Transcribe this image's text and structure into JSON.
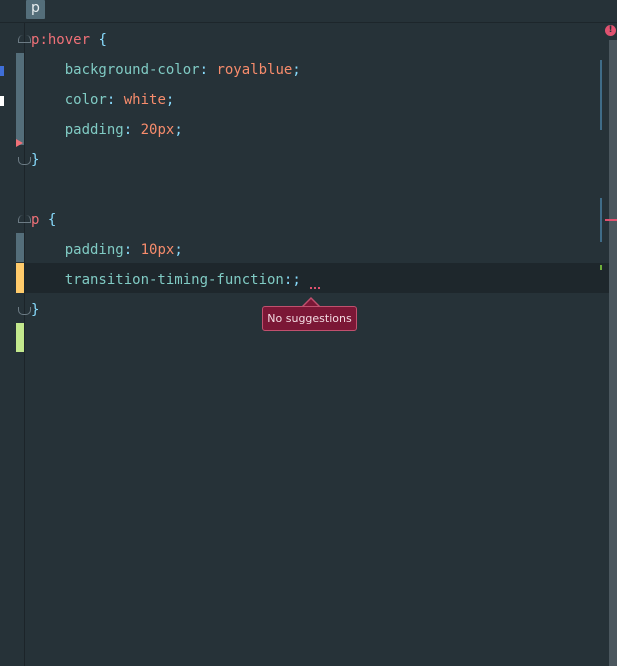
{
  "breadcrumb": {
    "item": "p"
  },
  "status": {
    "error_glyph": "!"
  },
  "code": {
    "line1": {
      "selector": "p",
      "pseudo": ":hover",
      "brace": " {"
    },
    "line2": {
      "prop": "background-color",
      "colon": ": ",
      "value": "royalblue",
      "semi": ";"
    },
    "line3": {
      "prop": "color",
      "colon": ": ",
      "value": "white",
      "semi": ";"
    },
    "line4": {
      "prop": "padding",
      "colon": ": ",
      "value": "20px",
      "semi": ";"
    },
    "line5": {
      "brace": "}"
    },
    "line7": {
      "selector": "p",
      "brace": " {"
    },
    "line8": {
      "prop": "padding",
      "colon": ": ",
      "value": "10px",
      "semi": ";"
    },
    "line9": {
      "prop": "transition-timing-function",
      "colon": ":",
      "semi": ";"
    },
    "line10": {
      "brace": "}"
    }
  },
  "tooltip": {
    "text": "No suggestions"
  },
  "colors": {
    "background": "#263238",
    "selector": "#f07178",
    "property": "#80cbc4",
    "value": "#f78c6c",
    "punctuation": "#89ddff",
    "error": "#e05270"
  }
}
